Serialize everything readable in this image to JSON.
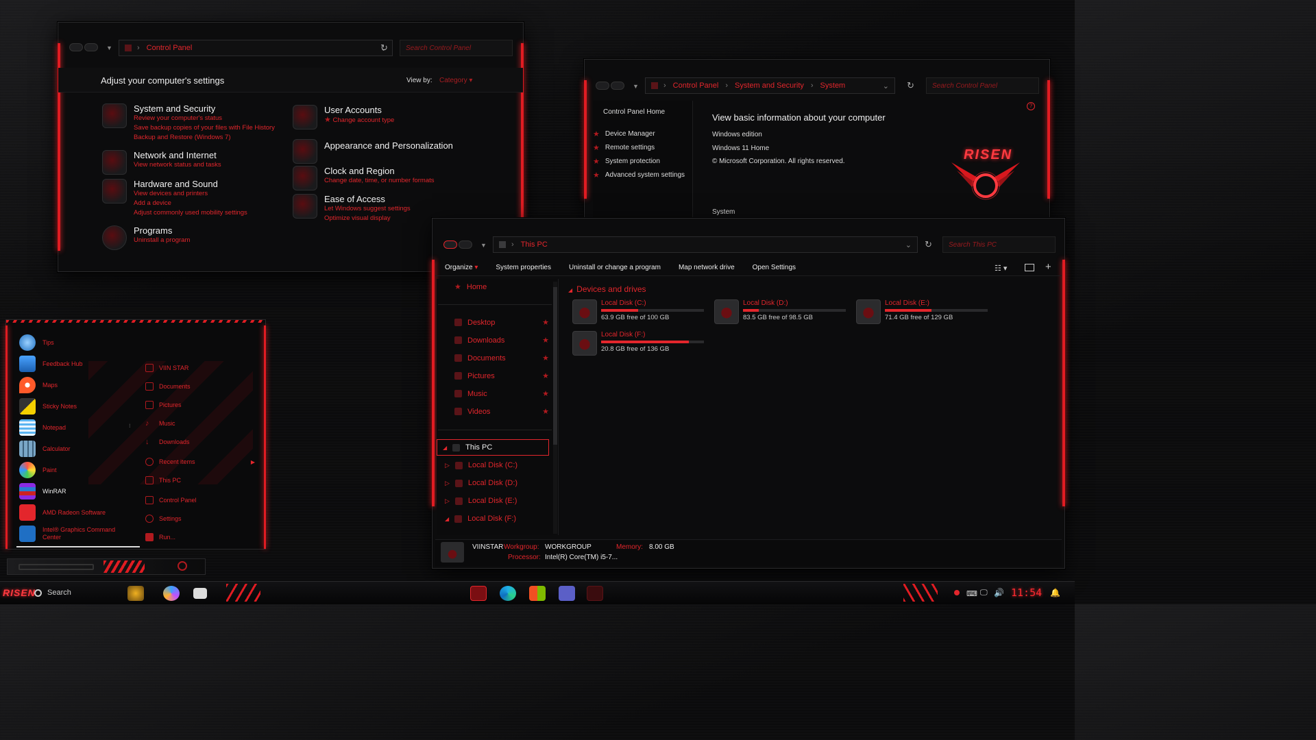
{
  "colors": {
    "accent": "#e3262c",
    "bg": "#0b0b0c",
    "panel": "#0c0c0d"
  },
  "cp": {
    "breadcrumb": "Control Panel",
    "search_placeholder": "Search Control Panel",
    "heading": "Adjust your computer's settings",
    "viewby_label": "View by:",
    "viewby_value": "Category",
    "categories_left": [
      {
        "title": "System and Security",
        "links": [
          "Review your computer's status",
          "Save backup copies of your files with File History",
          "Backup and Restore (Windows 7)"
        ]
      },
      {
        "title": "Network and Internet",
        "links": [
          "View network status and tasks"
        ]
      },
      {
        "title": "Hardware and Sound",
        "links": [
          "View devices and printers",
          "Add a device",
          "Adjust commonly used mobility settings"
        ]
      },
      {
        "title": "Programs",
        "links": [
          "Uninstall a program"
        ]
      }
    ],
    "categories_right": [
      {
        "title": "User Accounts",
        "links": [
          "Change account type"
        ]
      },
      {
        "title": "Appearance and Personalization",
        "links": []
      },
      {
        "title": "Clock and Region",
        "links": [
          "Change date, time, or number formats"
        ]
      },
      {
        "title": "Ease of Access",
        "links": [
          "Let Windows suggest settings",
          "Optimize visual display"
        ]
      }
    ]
  },
  "sys": {
    "crumbs": [
      "Control Panel",
      "System and Security",
      "System"
    ],
    "search_placeholder": "Search Control Panel",
    "home": "Control Panel Home",
    "links": [
      "Device Manager",
      "Remote settings",
      "System protection",
      "Advanced system settings"
    ],
    "heading": "View basic information about your computer",
    "edition_label": "Windows edition",
    "edition": "Windows 11 Home",
    "copyright": "© Microsoft Corporation. All rights reserved.",
    "section": "System",
    "logo_text": "RISEN",
    "help_icon": "help-icon"
  },
  "explorer": {
    "crumb": "This PC",
    "search_placeholder": "Search This PC",
    "toolbar": [
      "Organize",
      "System properties",
      "Uninstall or change a program",
      "Map network drive",
      "Open Settings"
    ],
    "nav_home": "Home",
    "quick": [
      "Desktop",
      "Downloads",
      "Documents",
      "Pictures",
      "Music",
      "Videos"
    ],
    "thispc": "This PC",
    "disks": [
      "Local Disk (C:)",
      "Local Disk (D:)",
      "Local Disk (E:)",
      "Local Disk (F:)"
    ],
    "section": "Devices and drives",
    "drives": [
      {
        "name": "Local Disk (C:)",
        "free": "63.9 GB free of 100 GB",
        "used_fraction": 0.36
      },
      {
        "name": "Local Disk (D:)",
        "free": "83.5 GB free of 98.5 GB",
        "used_fraction": 0.15
      },
      {
        "name": "Local Disk (E:)",
        "free": "71.4 GB free of 129 GB",
        "used_fraction": 0.45
      },
      {
        "name": "Local Disk (F:)",
        "free": "20.8 GB free of 136 GB",
        "used_fraction": 0.85
      }
    ],
    "status": {
      "pc": "VIINSTAR",
      "wg_label": "Workgroup:",
      "wg": "WORKGROUP",
      "mem_label": "Memory:",
      "mem": "8.00 GB",
      "cpu_label": "Processor:",
      "cpu": "Intel(R) Core(TM) i5-7..."
    }
  },
  "startmenu": {
    "apps": [
      "Tips",
      "Feedback Hub",
      "Maps",
      "Sticky Notes",
      "Notepad",
      "Calculator",
      "Paint",
      "WinRAR",
      "AMD Radeon Software",
      "Intel® Graphics Command Center"
    ],
    "places": [
      "VIIN STAR",
      "Documents",
      "Pictures",
      "Music",
      "Downloads",
      "Recent items",
      "This PC",
      "Control Panel",
      "Settings",
      "Run..."
    ]
  },
  "taskbar": {
    "logo": "RISEN",
    "search": "Search",
    "time": "11:54"
  }
}
